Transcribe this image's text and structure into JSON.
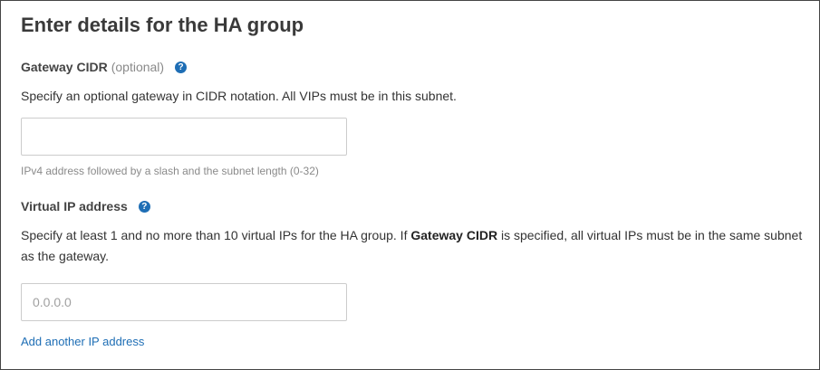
{
  "page": {
    "title": "Enter details for the HA group"
  },
  "gateway": {
    "label": "Gateway CIDR",
    "optional": "(optional)",
    "help_glyph": "?",
    "help_icon": "question-circle-icon",
    "description": "Specify an optional gateway in CIDR notation. All VIPs must be in this subnet.",
    "value": "",
    "placeholder": "",
    "hint": "IPv4 address followed by a slash and the subnet length (0-32)"
  },
  "vip": {
    "label": "Virtual IP address",
    "help_glyph": "?",
    "help_icon": "question-circle-icon",
    "description_part1": "Specify at least 1 and no more than 10 virtual IPs for the HA group. If ",
    "description_bold": "Gateway CIDR",
    "description_part2": " is specified, all virtual IPs must be in the same subnet as the gateway.",
    "value": "",
    "placeholder": "0.0.0.0",
    "add_link": "Add another IP address"
  },
  "colors": {
    "link": "#1e6eb5",
    "help_icon_bg": "#1e6eb5",
    "text": "#333333",
    "muted": "#8a8a8a",
    "border": "#cccccc"
  }
}
